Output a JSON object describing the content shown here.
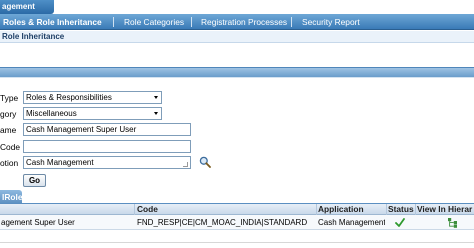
{
  "app_tab": {
    "title": "agement"
  },
  "tabs": [
    {
      "label": "Roles & Role Inheritance",
      "active": true
    },
    {
      "label": "Role Categories",
      "active": false
    },
    {
      "label": "Registration Processes",
      "active": false
    },
    {
      "label": "Security Report",
      "active": false
    }
  ],
  "page_label": "Role Inheritance",
  "form": {
    "type": {
      "label": "Type",
      "value": "Roles & Responsibilities"
    },
    "category": {
      "label": "gory",
      "value": "Miscellaneous"
    },
    "name": {
      "label": "ame",
      "value": "Cash Management Super User"
    },
    "code": {
      "label": "Code",
      "value": ""
    },
    "application": {
      "label": "otion",
      "value": "Cash Management"
    },
    "go_label": "Go"
  },
  "results": {
    "section_title": "lRole",
    "columns": [
      "Code",
      "Application",
      "Status",
      "View In Hierar"
    ],
    "rows": [
      {
        "name": "agement Super User",
        "code": "FND_RESP|CE|CM_MOAC_INDIA|STANDARD",
        "application": "Cash Management",
        "status": "check-icon",
        "hierarchy": "hierarchy-icon"
      }
    ]
  },
  "colors": {
    "tab_blue": "#3a7ab7",
    "check_green": "#2e9a2e"
  }
}
